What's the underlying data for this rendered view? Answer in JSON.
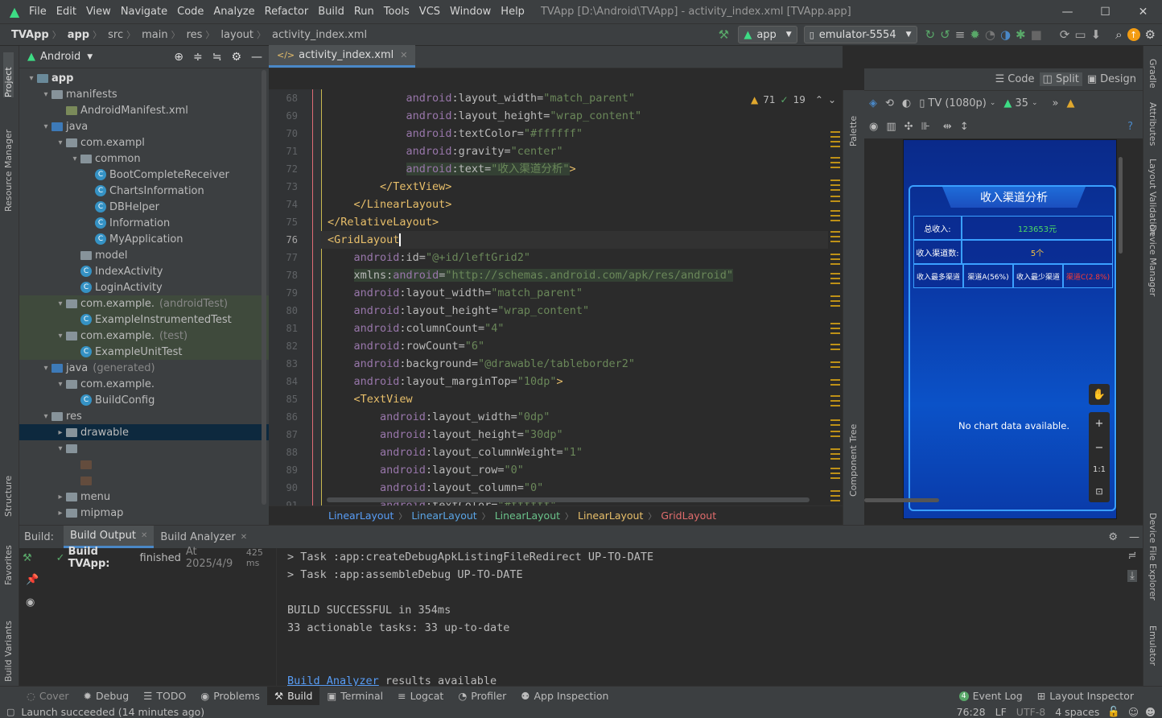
{
  "titlebar": {
    "menus": [
      "File",
      "Edit",
      "View",
      "Navigate",
      "Code",
      "Analyze",
      "Refactor",
      "Build",
      "Run",
      "Tools",
      "VCS",
      "Window",
      "Help"
    ],
    "title": "TVApp [D:\\Android\\TVApp] - activity_index.xml [TVApp.app]"
  },
  "navbar": {
    "crumbs": [
      "TVApp",
      "app",
      "src",
      "main",
      "res",
      "layout",
      "activity_index.xml"
    ],
    "run_config": "app",
    "device": "emulator-5554"
  },
  "left_stripe": {
    "project": "Project",
    "resource_manager": "Resource Manager",
    "structure": "Structure",
    "favorites": "Favorites",
    "build_variants": "Build Variants"
  },
  "right_stripe": {
    "gradle": "Gradle",
    "attributes": "Attributes",
    "layout_validation": "Layout Validation",
    "device_manager": "Device Manager",
    "device_file_explorer": "Device File Explorer",
    "emulator": "Emulator"
  },
  "project": {
    "view": "Android",
    "tree": [
      {
        "label": "app",
        "depth": 0,
        "type": "module",
        "open": true
      },
      {
        "label": "manifests",
        "depth": 1,
        "type": "folder",
        "open": true
      },
      {
        "label": "AndroidManifest.xml",
        "depth": 2,
        "type": "manifest"
      },
      {
        "label": "java",
        "depth": 1,
        "type": "folder-blue",
        "open": true
      },
      {
        "label": "com.exampl",
        "depth": 2,
        "type": "package",
        "open": true
      },
      {
        "label": "common",
        "depth": 3,
        "type": "package",
        "open": true
      },
      {
        "label": "BootCompleteReceiver",
        "depth": 4,
        "type": "class"
      },
      {
        "label": "ChartsInformation",
        "depth": 4,
        "type": "class"
      },
      {
        "label": "DBHelper",
        "depth": 4,
        "type": "class"
      },
      {
        "label": "Information",
        "depth": 4,
        "type": "class"
      },
      {
        "label": "MyApplication",
        "depth": 4,
        "type": "class"
      },
      {
        "label": "model",
        "depth": 3,
        "type": "package"
      },
      {
        "label": "IndexActivity",
        "depth": 3,
        "type": "class"
      },
      {
        "label": "LoginActivity",
        "depth": 3,
        "type": "class"
      },
      {
        "label": "com.example.",
        "suffix": "(androidTest)",
        "depth": 2,
        "type": "package",
        "open": true,
        "test": true
      },
      {
        "label": "ExampleInstrumentedTest",
        "depth": 3,
        "type": "class",
        "test": true
      },
      {
        "label": "com.example.",
        "suffix": "(test)",
        "depth": 2,
        "type": "package",
        "open": true,
        "test": true
      },
      {
        "label": "ExampleUnitTest",
        "depth": 3,
        "type": "class",
        "test": true
      },
      {
        "label": "java",
        "suffix": "(generated)",
        "depth": 1,
        "type": "folder-blue",
        "open": true
      },
      {
        "label": "com.example.",
        "depth": 2,
        "type": "package",
        "open": true
      },
      {
        "label": "BuildConfig",
        "depth": 3,
        "type": "class"
      },
      {
        "label": "res",
        "depth": 1,
        "type": "folder",
        "open": true
      },
      {
        "label": "drawable",
        "depth": 2,
        "type": "folder",
        "closed": true,
        "selected": true
      },
      {
        "label": "",
        "depth": 2,
        "type": "folder",
        "open": true
      },
      {
        "label": "",
        "depth": 3,
        "type": "blank"
      },
      {
        "label": "",
        "depth": 3,
        "type": "blank"
      },
      {
        "label": "menu",
        "depth": 2,
        "type": "folder",
        "closed": true
      },
      {
        "label": "mipmap",
        "depth": 2,
        "type": "folder",
        "closed": true
      }
    ]
  },
  "editor": {
    "tab": "activity_index.xml",
    "warnings": "71",
    "weak_warnings": "19",
    "lines": [
      {
        "n": "68",
        "parts": [
          [
            "ind",
            "            "
          ],
          [
            "ns",
            "android"
          ],
          [
            "at",
            ":layout_width="
          ],
          [
            "val",
            "\"match_parent\""
          ]
        ]
      },
      {
        "n": "69",
        "parts": [
          [
            "ind",
            "            "
          ],
          [
            "ns",
            "android"
          ],
          [
            "at",
            ":layout_height="
          ],
          [
            "val",
            "\"wrap_content\""
          ]
        ]
      },
      {
        "n": "70",
        "parts": [
          [
            "ind",
            "            "
          ],
          [
            "ns",
            "android"
          ],
          [
            "at",
            ":textColor="
          ],
          [
            "val",
            "\"#ffffff\""
          ]
        ]
      },
      {
        "n": "71",
        "parts": [
          [
            "ind",
            "            "
          ],
          [
            "ns",
            "android"
          ],
          [
            "at",
            ":gravity="
          ],
          [
            "val",
            "\"center\""
          ]
        ]
      },
      {
        "n": "72",
        "parts": [
          [
            "ind",
            "            "
          ],
          [
            "nshl",
            "android"
          ],
          [
            "athl",
            ":text="
          ],
          [
            "valhl",
            "\"收入渠道分析\""
          ],
          [
            "tag",
            ">"
          ]
        ]
      },
      {
        "n": "73",
        "parts": [
          [
            "ind",
            "        "
          ],
          [
            "tag",
            "</TextView>"
          ]
        ]
      },
      {
        "n": "74",
        "parts": [
          [
            "ind",
            "    "
          ],
          [
            "tag",
            "</LinearLayout>"
          ]
        ]
      },
      {
        "n": "75",
        "parts": [
          [
            "ind",
            ""
          ],
          [
            "tag",
            "</RelativeLayout>"
          ]
        ]
      },
      {
        "n": "76",
        "parts": [
          [
            "ind",
            ""
          ],
          [
            "tag",
            "<GridLayout"
          ]
        ],
        "current": true
      },
      {
        "n": "77",
        "parts": [
          [
            "ind",
            "    "
          ],
          [
            "ns",
            "android"
          ],
          [
            "at",
            ":id="
          ],
          [
            "val",
            "\"@+id/leftGrid2\""
          ]
        ]
      },
      {
        "n": "78",
        "parts": [
          [
            "ind",
            "    "
          ],
          [
            "athl",
            "xmlns:"
          ],
          [
            "nshl",
            "android"
          ],
          [
            "athl",
            "="
          ],
          [
            "valhl",
            "\"http://schemas.android.com/apk/res/android\""
          ]
        ]
      },
      {
        "n": "79",
        "parts": [
          [
            "ind",
            "    "
          ],
          [
            "ns",
            "android"
          ],
          [
            "at",
            ":layout_width="
          ],
          [
            "val",
            "\"match_parent\""
          ]
        ]
      },
      {
        "n": "80",
        "parts": [
          [
            "ind",
            "    "
          ],
          [
            "ns",
            "android"
          ],
          [
            "at",
            ":layout_height="
          ],
          [
            "val",
            "\"wrap_content\""
          ]
        ]
      },
      {
        "n": "81",
        "parts": [
          [
            "ind",
            "    "
          ],
          [
            "ns",
            "android"
          ],
          [
            "at",
            ":columnCount="
          ],
          [
            "val",
            "\"4\""
          ]
        ]
      },
      {
        "n": "82",
        "parts": [
          [
            "ind",
            "    "
          ],
          [
            "ns",
            "android"
          ],
          [
            "at",
            ":rowCount="
          ],
          [
            "val",
            "\"6\""
          ]
        ]
      },
      {
        "n": "83",
        "parts": [
          [
            "ind",
            "    "
          ],
          [
            "ns",
            "android"
          ],
          [
            "at",
            ":background="
          ],
          [
            "val",
            "\"@drawable/tableborder2\""
          ]
        ]
      },
      {
        "n": "84",
        "parts": [
          [
            "ind",
            "    "
          ],
          [
            "ns",
            "android"
          ],
          [
            "at",
            ":layout_marginTop="
          ],
          [
            "val",
            "\"10dp\""
          ],
          [
            "tag",
            ">"
          ]
        ]
      },
      {
        "n": "85",
        "parts": [
          [
            "ind",
            "    "
          ],
          [
            "tag",
            "<TextView"
          ]
        ]
      },
      {
        "n": "86",
        "parts": [
          [
            "ind",
            "        "
          ],
          [
            "ns",
            "android"
          ],
          [
            "at",
            ":layout_width="
          ],
          [
            "val",
            "\"0dp\""
          ]
        ]
      },
      {
        "n": "87",
        "parts": [
          [
            "ind",
            "        "
          ],
          [
            "ns",
            "android"
          ],
          [
            "at",
            ":layout_height="
          ],
          [
            "val",
            "\"30dp\""
          ]
        ]
      },
      {
        "n": "88",
        "parts": [
          [
            "ind",
            "        "
          ],
          [
            "ns",
            "android"
          ],
          [
            "at",
            ":layout_columnWeight="
          ],
          [
            "val",
            "\"1\""
          ]
        ]
      },
      {
        "n": "89",
        "parts": [
          [
            "ind",
            "        "
          ],
          [
            "ns",
            "android"
          ],
          [
            "at",
            ":layout_row="
          ],
          [
            "val",
            "\"0\""
          ]
        ]
      },
      {
        "n": "90",
        "parts": [
          [
            "ind",
            "        "
          ],
          [
            "ns",
            "android"
          ],
          [
            "at",
            ":layout_column="
          ],
          [
            "val",
            "\"0\""
          ]
        ]
      },
      {
        "n": "91",
        "parts": [
          [
            "ind",
            "        "
          ],
          [
            "ns",
            "android"
          ],
          [
            "at",
            ":textColor="
          ],
          [
            "val",
            "\"#ffffff\""
          ]
        ]
      }
    ],
    "breadcrumb": [
      "LinearLayout",
      "LinearLayout",
      "LinearLayout",
      "LinearLayout",
      "GridLayout"
    ]
  },
  "design": {
    "modes": {
      "code": "Code",
      "split": "Split",
      "design": "Design"
    },
    "device": "TV (1080p)",
    "api": "35",
    "palette": "Palette",
    "component_tree": "Component Tree",
    "preview": {
      "header": "收入渠道分析",
      "rows": [
        [
          "总收入:",
          "123653元"
        ],
        [
          "收入渠道数:",
          "5个"
        ],
        [
          "收入最多渠道",
          "渠道A(56%)",
          "收入最少渠道",
          "渠道C(2.8%)"
        ]
      ],
      "empty_chart": "No chart data available.",
      "zoom_fit": "1:1"
    }
  },
  "build": {
    "label": "Build:",
    "tabs": [
      "Build Output",
      "Build Analyzer"
    ],
    "status_bold": "Build TVApp:",
    "status_rest": "finished",
    "status_time": "At 2025/4/9",
    "status_dur": "425 ms",
    "output": [
      "> Task :app:createDebugApkListingFileRedirect UP-TO-DATE",
      "> Task :app:assembleDebug UP-TO-DATE",
      "",
      "BUILD SUCCESSFUL in 354ms",
      "33 actionable tasks: 33 up-to-date",
      "",
      ""
    ],
    "analyzer_link": "Build Analyzer",
    "analyzer_rest": " results available"
  },
  "toolwindows": {
    "left": [
      "Cover",
      "Debug",
      "TODO",
      "Problems",
      "Build",
      "Terminal",
      "Logcat",
      "Profiler",
      "App Inspection"
    ],
    "right": [
      "Event Log",
      "Layout Inspector"
    ],
    "event_count": "4"
  },
  "status": {
    "message": "Launch succeeded (14 minutes ago)",
    "position": "76:28",
    "line_sep": "LF",
    "encoding": "UTF-8",
    "indent": "4 spaces"
  }
}
